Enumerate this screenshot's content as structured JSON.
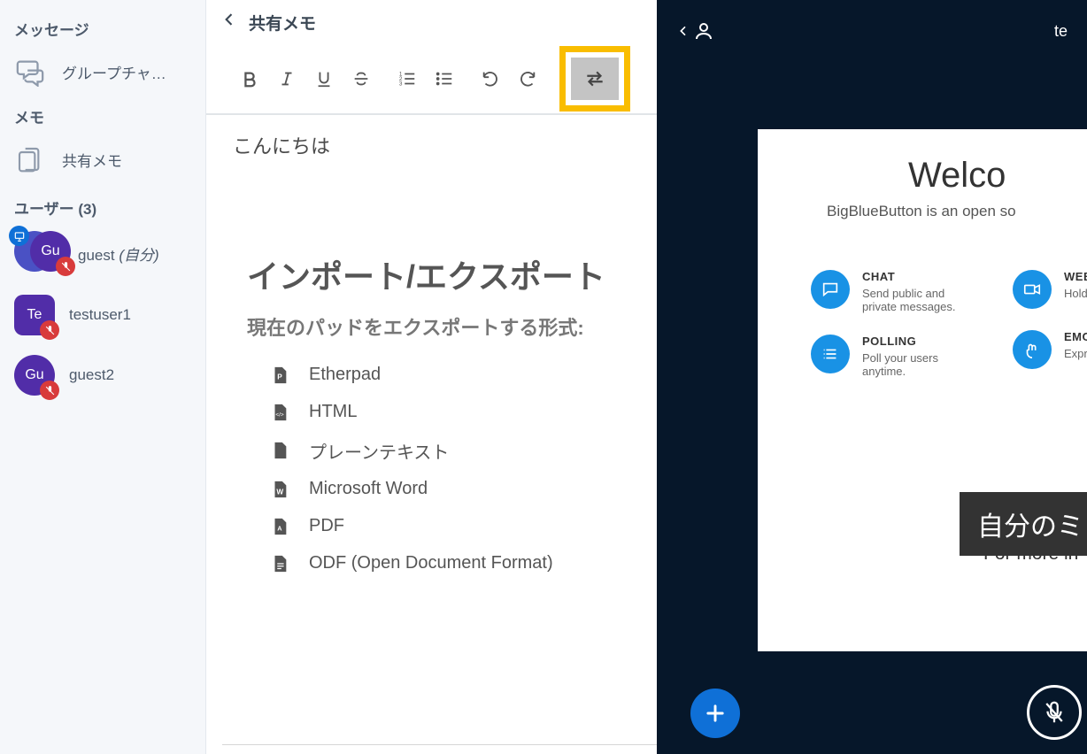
{
  "sidebar": {
    "messages_header": "メッセージ",
    "group_chat_label": "グループチャ…",
    "notes_header": "メモ",
    "shared_notes_label": "共有メモ",
    "users_header": "ユーザー (3)",
    "users": [
      {
        "initials": "Gu",
        "name": "guest",
        "self_suffix": " (自分)",
        "presenter": true,
        "muted": true
      },
      {
        "initials": "Te",
        "name": "testuser1",
        "muted": true
      },
      {
        "initials": "Gu",
        "name": "guest2",
        "muted": true
      }
    ]
  },
  "notes": {
    "back_title": "共有メモ",
    "content_line": "こんにちは",
    "dialog_title": "インポート/エクスポート",
    "dialog_sub": "現在のパッドをエクスポートする形式:",
    "exports": {
      "etherpad": "Etherpad",
      "html": "HTML",
      "plain": "プレーンテキスト",
      "word": "Microsoft Word",
      "pdf": "PDF",
      "odf": "ODF (Open Document Format)"
    }
  },
  "main": {
    "meeting_title_fragment": "te",
    "slide_title": "Welco",
    "slide_sub": "BigBlueButton is an open so",
    "features": {
      "chat_title": "CHAT",
      "chat_desc": "Send public and private messages.",
      "polling_title": "POLLING",
      "polling_desc": "Poll your users anytime.",
      "webcam_title": "WEBCA",
      "webcam_desc": "Hold vi",
      "emoji_title": "EMOJIS",
      "emoji_desc": "Express"
    },
    "more_info": "For more in",
    "tooltip": "自分のミュート"
  }
}
